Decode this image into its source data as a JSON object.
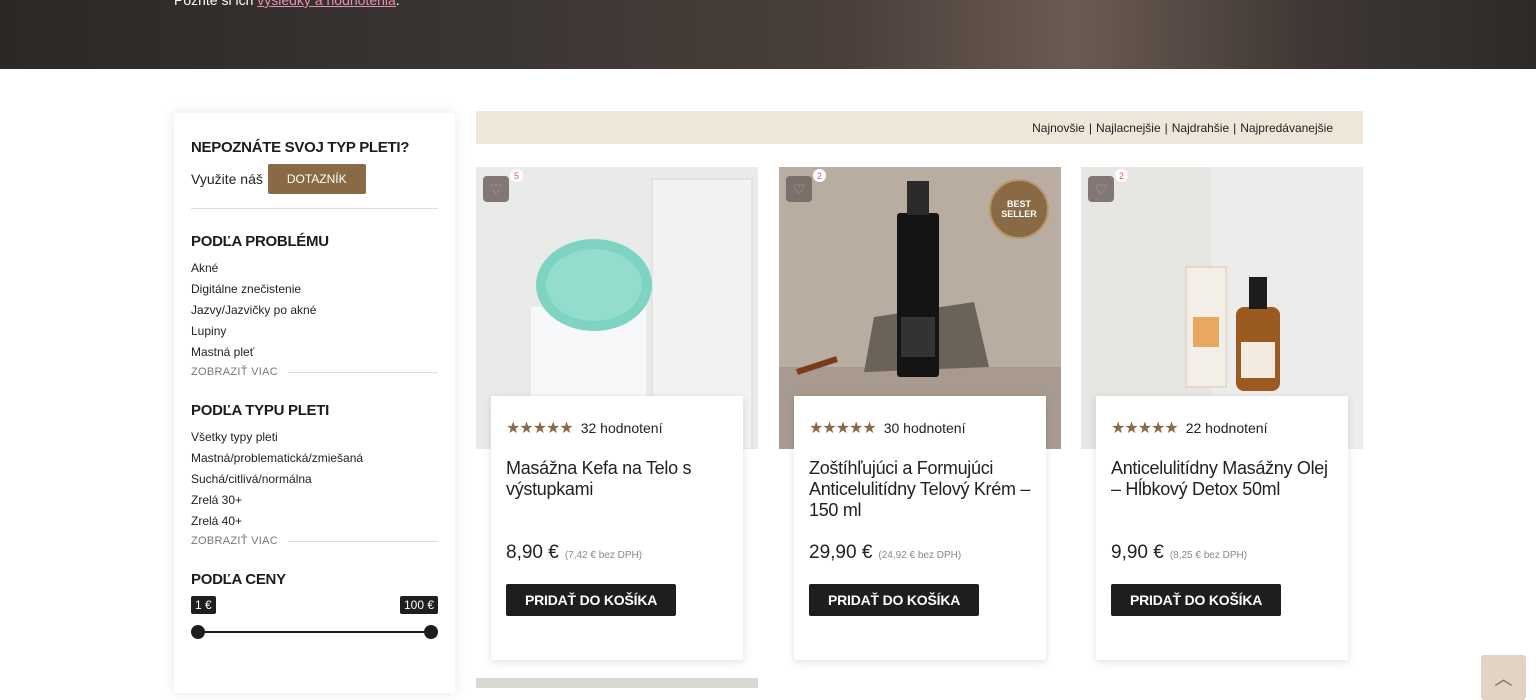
{
  "hero": {
    "text_prefix": "Pozrite si ich",
    "link": "výsledky a hodnotenia",
    "text_suffix": "."
  },
  "sidebar": {
    "quiz": {
      "heading": "NEPOZNÁTE SVOJ TYP PLETI?",
      "prefix": "Využite náš",
      "button": "DOTAZNÍK"
    },
    "problem": {
      "heading": "PODĽA PROBLÉMU",
      "items": [
        "Akné",
        "Digitálne znečistenie",
        "Jazvy/Jazvičky po akné",
        "Lupiny",
        "Mastná pleť"
      ],
      "more": "ZOBRAZIŤ VIAC"
    },
    "skin": {
      "heading": "PODĽA TYPU PLETI",
      "items": [
        "Všetky typy pleti",
        "Mastná/problematická/zmiešaná",
        "Suchá/citlivá/normálna",
        "Zrelá 30+",
        "Zrelá 40+"
      ],
      "more": "ZOBRAZIŤ VIAC"
    },
    "price": {
      "heading": "PODĽA CENY",
      "min": "1 €",
      "max": "100 €"
    }
  },
  "sort": {
    "options": [
      "Najnovšie",
      "Najlacnejšie",
      "Najdrahšie",
      "Najpredávanejšie"
    ],
    "separator": "|"
  },
  "products": [
    {
      "wishlist_count": "5",
      "reviews": "32 hodnotení",
      "title": "Masážna Kefa na Telo s výstupkami",
      "price": "8,90 €",
      "price_net": "(7,42 € bez DPH)",
      "cart": "PRIDAŤ DO KOŠÍKA"
    },
    {
      "wishlist_count": "2",
      "badge": "BEST SELLER",
      "reviews": "30 hodnotení",
      "title": "Zoštíhľujúci a Formujúci Anticelulitídny Telový Krém – 150 ml",
      "price": "29,90 €",
      "price_net": "(24,92 € bez DPH)",
      "cart": "PRIDAŤ DO KOŠÍKA"
    },
    {
      "wishlist_count": "2",
      "reviews": "22 hodnotení",
      "title": "Anticelulitídny Masážny Olej – Hĺbkový Detox 50ml",
      "price": "9,90 €",
      "price_net": "(8,25 € bez DPH)",
      "cart": "PRIDAŤ DO KOŠÍKA"
    }
  ],
  "colors": {
    "accent_brown": "#8a6a44",
    "sort_bg": "#efe6da",
    "dark": "#1e1e1e",
    "link_pink": "#e58fb4"
  },
  "icons": {
    "wishlist": "heart-icon",
    "scroll_top": "chevron-up-icon",
    "rating": "star-icon"
  },
  "ratings": [
    5,
    5,
    5
  ]
}
